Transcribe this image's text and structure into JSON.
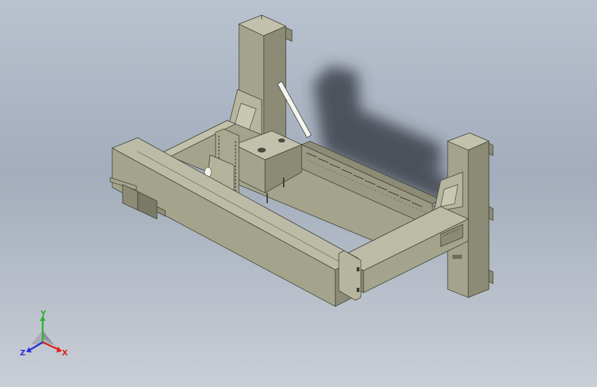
{
  "viewport": {
    "background_top": "#b9c2cf",
    "background_bottom": "#c9ced6"
  },
  "model": {
    "body_color": "#a4a48c",
    "body_light": "#bcbca6",
    "body_dark": "#8a8a74",
    "shadow_color": "#3a3f48"
  },
  "triad": {
    "x_label": "X",
    "y_label": "Y",
    "z_label": "Z",
    "x_color": "#e0211b",
    "y_color": "#2fb12f",
    "z_color": "#2b2fd6"
  }
}
